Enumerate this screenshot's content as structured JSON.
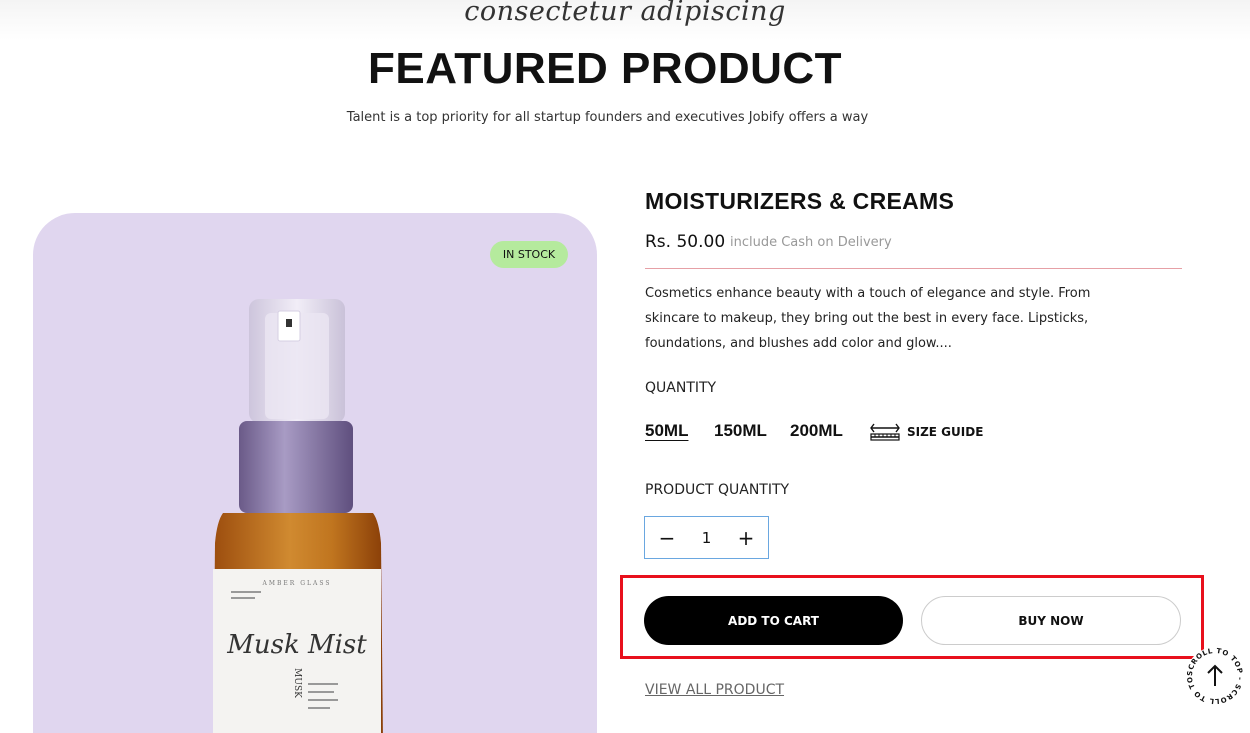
{
  "header": {
    "script_text": "consectetur adipiscing",
    "title": "FEATURED PRODUCT",
    "subtitle": "Talent is a top priority for all startup founders and executives Jobify offers a way"
  },
  "image": {
    "badge": "IN STOCK",
    "label_small": "AMBER GLASS",
    "label_script": "Musk Mist",
    "label_vertical": "MUSK"
  },
  "product": {
    "title": "MOISTURIZERS & CREAMS",
    "price": "Rs. 50.00",
    "price_note": "include Cash on Delivery",
    "description": "Cosmetics enhance beauty with a touch of elegance and style. From skincare to makeup, they bring out the best in every face. Lipsticks, foundations, and blushes add color and glow....",
    "quantity_label": "QUANTITY",
    "sizes": [
      "50ML",
      "150ML",
      "200ML"
    ],
    "selected_size": "50ML",
    "size_guide_label": "SIZE GUIDE",
    "product_quantity_label": "PRODUCT QUANTITY",
    "quantity_value": "1",
    "minus_label": "−",
    "plus_label": "+",
    "add_to_cart_label": "ADD TO CART",
    "buy_now_label": "BUY NOW",
    "view_all_label": "VIEW ALL PRODUCT"
  },
  "scroll_top": {
    "ring_text": "SCROLL TO TOP - SCROLL TO TOP - "
  },
  "colors": {
    "image_bg": "#e0d6ef",
    "badge_bg": "#b5ea9d",
    "divider": "#e6a0a6",
    "highlight": "#e8101c",
    "stepper_border": "#6aa7e0"
  }
}
